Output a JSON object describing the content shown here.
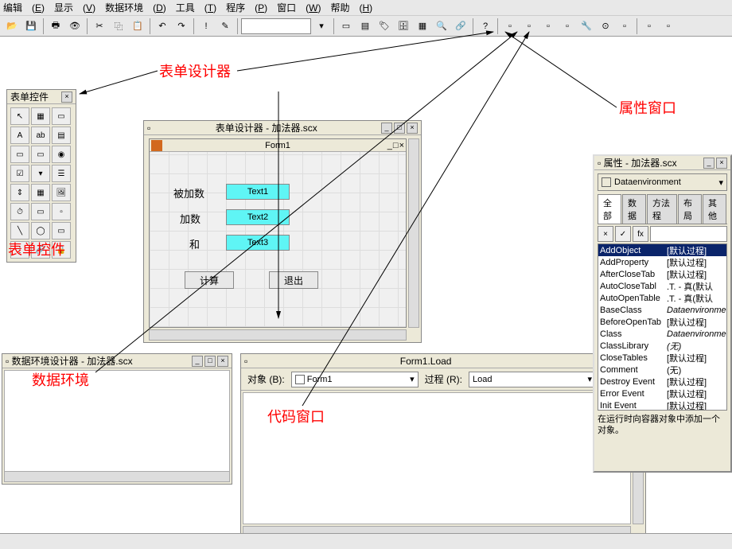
{
  "menubar": {
    "items": [
      {
        "label": "编辑",
        "key": "E"
      },
      {
        "label": "显示",
        "key": "V"
      },
      {
        "label": "数据环境",
        "key": "D"
      },
      {
        "label": "工具",
        "key": "T"
      },
      {
        "label": "程序",
        "key": "P"
      },
      {
        "label": "窗口",
        "key": "W"
      },
      {
        "label": "帮助",
        "key": "H"
      }
    ]
  },
  "toolbox": {
    "title": "表单控件"
  },
  "form_designer": {
    "title": "表单设计器 - 加法器.scx",
    "form_name": "Form1",
    "labels": {
      "l1": "被加数",
      "l2": "加数",
      "l3": "和"
    },
    "texts": {
      "t1": "Text1",
      "t2": "Text2",
      "t3": "Text3"
    },
    "buttons": {
      "b1": "计算",
      "b2": "退出"
    }
  },
  "dataenv": {
    "title": "数据环境设计器 - 加法器.scx"
  },
  "code": {
    "title": "Form1.Load",
    "obj_label": "对象 (B):",
    "obj_value": "Form1",
    "proc_label": "过程 (R):",
    "proc_value": "Load"
  },
  "props": {
    "title": "属性 - 加法器.scx",
    "object": "Dataenvironment",
    "tabs": [
      "全部",
      "数据",
      "方法程",
      "布局",
      "其他"
    ],
    "rows": [
      {
        "name": "AddObject",
        "val": "[默认过程]",
        "sel": true
      },
      {
        "name": "AddProperty",
        "val": "[默认过程]"
      },
      {
        "name": "AfterCloseTab",
        "val": "[默认过程]"
      },
      {
        "name": "AutoCloseTabl",
        "val": ".T. - 真(默认"
      },
      {
        "name": "AutoOpenTable",
        "val": ".T. - 真(默认"
      },
      {
        "name": "BaseClass",
        "val": "Dataenvironme",
        "italic": true
      },
      {
        "name": "BeforeOpenTab",
        "val": "[默认过程]"
      },
      {
        "name": "Class",
        "val": "Dataenvironme",
        "italic": true
      },
      {
        "name": "ClassLibrary",
        "val": "(无)",
        "italic": true
      },
      {
        "name": "CloseTables",
        "val": "[默认过程]"
      },
      {
        "name": "Comment",
        "val": "(无)"
      },
      {
        "name": "Destroy Event",
        "val": "[默认过程]"
      },
      {
        "name": "Error Event",
        "val": "[默认过程]"
      },
      {
        "name": "Init Event",
        "val": "[默认过程]"
      }
    ],
    "desc": "在运行时向容器对象中添加一个对象。"
  },
  "annotations": {
    "a1": "表单设计器",
    "a2": "属性窗口",
    "a3": "表单控件",
    "a4": "数据环境",
    "a5": "代码窗口"
  },
  "statusbar": {
    "text": ""
  }
}
